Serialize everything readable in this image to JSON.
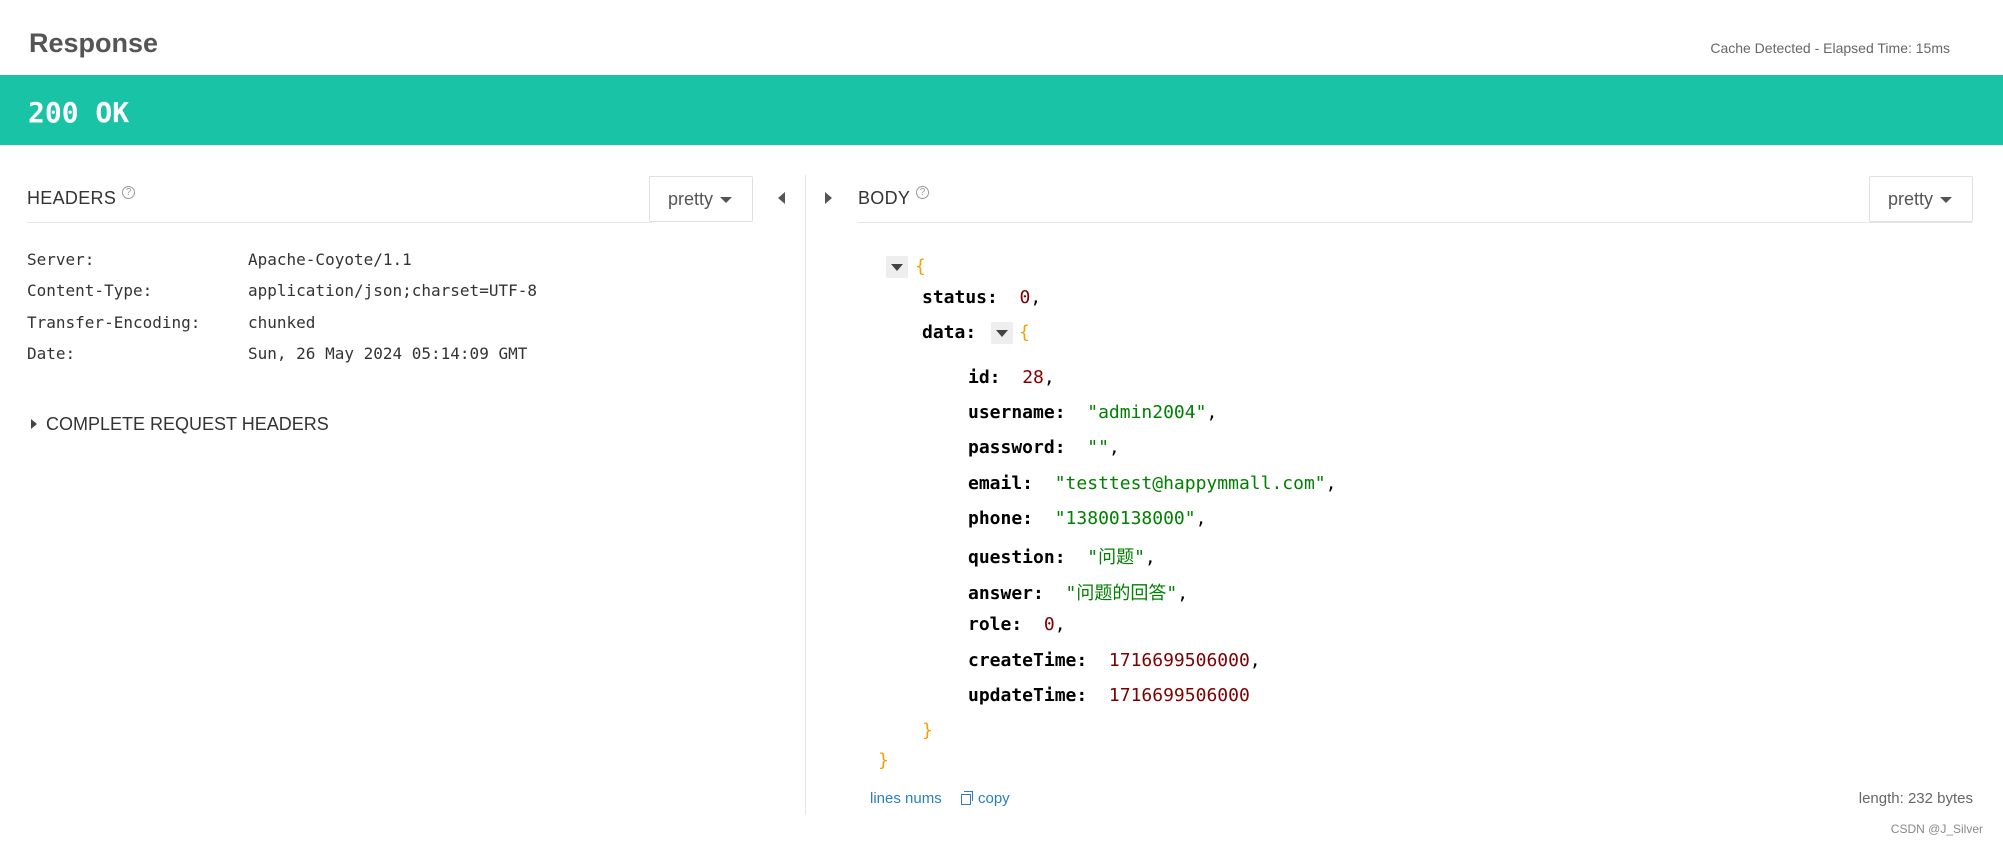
{
  "response": {
    "title": "Response",
    "cache_info": "Cache Detected - Elapsed Time: 15ms",
    "status": "200 OK"
  },
  "headers": {
    "section_title": "HEADERS",
    "help_glyph": "?",
    "format_label": "pretty",
    "rows": [
      {
        "key": "Server:",
        "value": "Apache-Coyote/1.1"
      },
      {
        "key": "Content-Type:",
        "value": "application/json;charset=UTF-8"
      },
      {
        "key": "Transfer-Encoding:",
        "value": "chunked"
      },
      {
        "key": "Date:",
        "value": "Sun, 26 May 2024 05:14:09 GMT"
      }
    ],
    "complete_label": "COMPLETE REQUEST HEADERS"
  },
  "body": {
    "section_title": "BODY",
    "help_glyph": "?",
    "format_label": "pretty",
    "json": {
      "open_brace": "{",
      "close_brace": "}",
      "status_key": "status:",
      "status_value": "0",
      "data_key": "data:",
      "fields": [
        {
          "key": "id:",
          "value": "28",
          "type": "number"
        },
        {
          "key": "username:",
          "value": "\"admin2004\"",
          "type": "string"
        },
        {
          "key": "password:",
          "value": "\"\"",
          "type": "string"
        },
        {
          "key": "email:",
          "value": "\"testtest@happymmall.com\"",
          "type": "string"
        },
        {
          "key": "phone:",
          "value": "\"13800138000\"",
          "type": "string"
        },
        {
          "key": "question:",
          "value": "\"问题\"",
          "type": "string"
        },
        {
          "key": "answer:",
          "value": "\"问题的回答\"",
          "type": "string"
        },
        {
          "key": "role:",
          "value": "0",
          "type": "number"
        },
        {
          "key": "createTime:",
          "value": "1716699506000",
          "type": "number"
        },
        {
          "key": "updateTime:",
          "value": "1716699506000",
          "type": "number"
        }
      ]
    },
    "lines_nums_label": "lines nums",
    "copy_label": "copy",
    "length_label": "length: 232 bytes"
  },
  "watermark": "CSDN @J_Silver",
  "colors": {
    "status_bar": "#18c3a6",
    "json_string": "#008000",
    "json_number": "#800000",
    "json_brace": "#f5a000",
    "link": "#2a7ec4"
  },
  "icons": [
    "help-icon",
    "caret-down-icon",
    "collapse-left-arrow-icon",
    "expand-right-arrow-icon",
    "expand-triangle-icon",
    "copy-icon",
    "collapse-toggle-icon"
  ]
}
